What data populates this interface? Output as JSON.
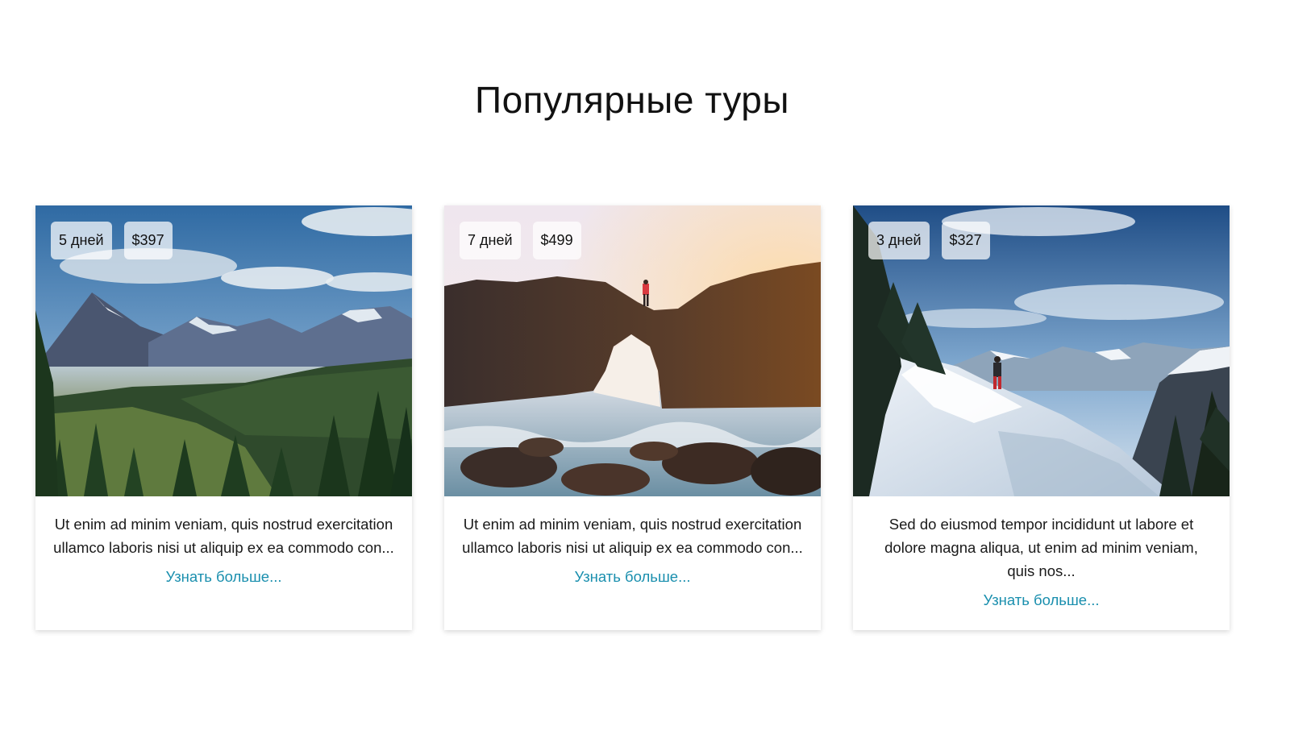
{
  "page": {
    "title": "Популярные туры"
  },
  "colors": {
    "link": "#1a8fae",
    "badge_bg": "rgba(255,255,255,0.72)",
    "text": "#1a1a1a"
  },
  "tours": [
    {
      "duration": "5 дней",
      "price": "$397",
      "description": "Ut enim ad minim veniam, quis nostrud exercitation ullamco laboris nisi ut aliquip ex ea commodo con...",
      "link_label": "Узнать больше...",
      "image": "mountain-valley-forest-photo"
    },
    {
      "duration": "7 дней",
      "price": "$499",
      "description": "Ut enim ad minim veniam, quis nostrud exercitation ullamco laboris nisi ut aliquip ex ea commodo con...",
      "link_label": "Узнать больше...",
      "image": "rock-arch-sea-photo"
    },
    {
      "duration": "3 дней",
      "price": "$327",
      "description": "Sed do eiusmod tempor incididunt ut labore et dolore magna aliqua, ut enim ad minim veniam, quis nos...",
      "link_label": "Узнать больше...",
      "image": "snowy-mountain-hiker-photo"
    }
  ]
}
